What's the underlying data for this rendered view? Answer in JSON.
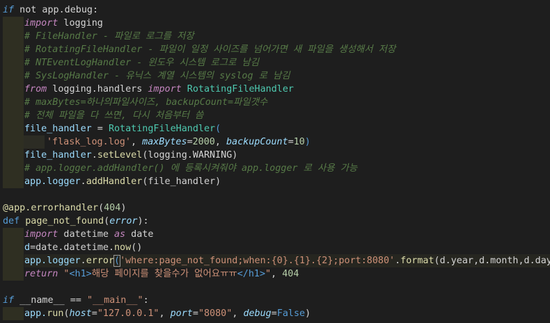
{
  "code": {
    "l1_if": "if",
    "l1_rest": " not app.debug:",
    "l2_import": "import",
    "l2_mod": " logging",
    "l3": "# FileHandler - 파일로 로그를 저장",
    "l4": "# RotatingFileHandler - 파일이 일정 사이즈를 넘어가면 새 파일을 생성해서 저장",
    "l5": "# NTEventLogHandler - 윈도우 시스템 로그로 남김",
    "l6": "# SysLogHandler - 유닉스 계열 시스템의 syslog 로 남김",
    "l7_from": "from",
    "l7_mod": " logging.handlers ",
    "l7_import": "import",
    "l7_cls": " RotatingFileHandler",
    "l8": "# maxBytes=하나의파일사이즈, backupCount=파일갯수",
    "l9": "# 전체 파일을 다 쓰면, 다시 처음부터 씀",
    "l10_var": "file_handler",
    "l10_eq": " = ",
    "l10_cls": "RotatingFileHandler",
    "l10_paren": "(",
    "l11_str": "'flask_log.log'",
    "l11_c1": ", ",
    "l11_p1": "maxBytes",
    "l11_eq1": "=",
    "l11_n1": "2000",
    "l11_c2": ", ",
    "l11_p2": "backupCount",
    "l11_eq2": "=",
    "l11_n2": "10",
    "l11_close": ")",
    "l12_var": "file_handler",
    "l12_dot": ".",
    "l12_fn": "setLevel",
    "l12_a": "(logging.WARNING)",
    "l13": "# app.logger.addHandler() 에 등록시켜줘야 app.logger 로 사용 가능",
    "l14_a": "app.",
    "l14_b": "logger",
    "l14_c": ".",
    "l14_fn": "addHandler",
    "l14_d": "(file_handler)",
    "l16_at": "@app.",
    "l16_fn": "errorhandler",
    "l16_open": "(",
    "l16_num": "404",
    "l16_close": ")",
    "l17_def": "def",
    "l17_fn": " page_not_found",
    "l17_open": "(",
    "l17_prm": "error",
    "l17_close": "):",
    "l18_import": "import",
    "l18_mod": " datetime ",
    "l18_as": "as",
    "l18_alias": " date",
    "l19_a": "d",
    "l19_b": "=date.datetime.",
    "l19_fn": "now",
    "l19_c": "()",
    "l20_a": "app.",
    "l20_b": "logger",
    "l20_c": ".",
    "l20_fn": "error",
    "l20_open": "(",
    "l20_str": "'where:page_not_found;when:{0}.{1}.{2};port:8080'",
    "l20_dot": ".",
    "l20_fmt": "format",
    "l20_args": "(d.year,d.month,d.day)",
    "l20_close": ")",
    "l21_ret": "return",
    "l21_q1": " \"",
    "l21_tag1": "<h1>",
    "l21_txt": "해당 페이지를 찾을수가 없어요ㅠㅠ",
    "l21_tag2": "</h1>",
    "l21_q2": "\"",
    "l21_comma": ", ",
    "l21_num": "404",
    "l23_if": "if",
    "l23_a": " __name__ == ",
    "l23_str": "\"__main__\"",
    "l23_colon": ":",
    "l24_a": "app.",
    "l24_fn": "run",
    "l24_open": "(",
    "l24_p1": "host",
    "l24_eq1": "=",
    "l24_s1": "\"127.0.0.1\"",
    "l24_c1": ", ",
    "l24_p2": "port",
    "l24_eq2": "=",
    "l24_s2": "\"8080\"",
    "l24_c2": ", ",
    "l24_p3": "debug",
    "l24_eq3": "=",
    "l24_v3": "False",
    "l24_close": ")"
  },
  "colors": {
    "background": "#1e1e1e",
    "keyword": "#569cd6",
    "control": "#c586c0",
    "comment": "#6a9955",
    "function": "#dcdcaa",
    "class": "#4ec9b0",
    "string": "#ce9178",
    "number": "#b5cea8",
    "parameter": "#9cdcfe"
  }
}
